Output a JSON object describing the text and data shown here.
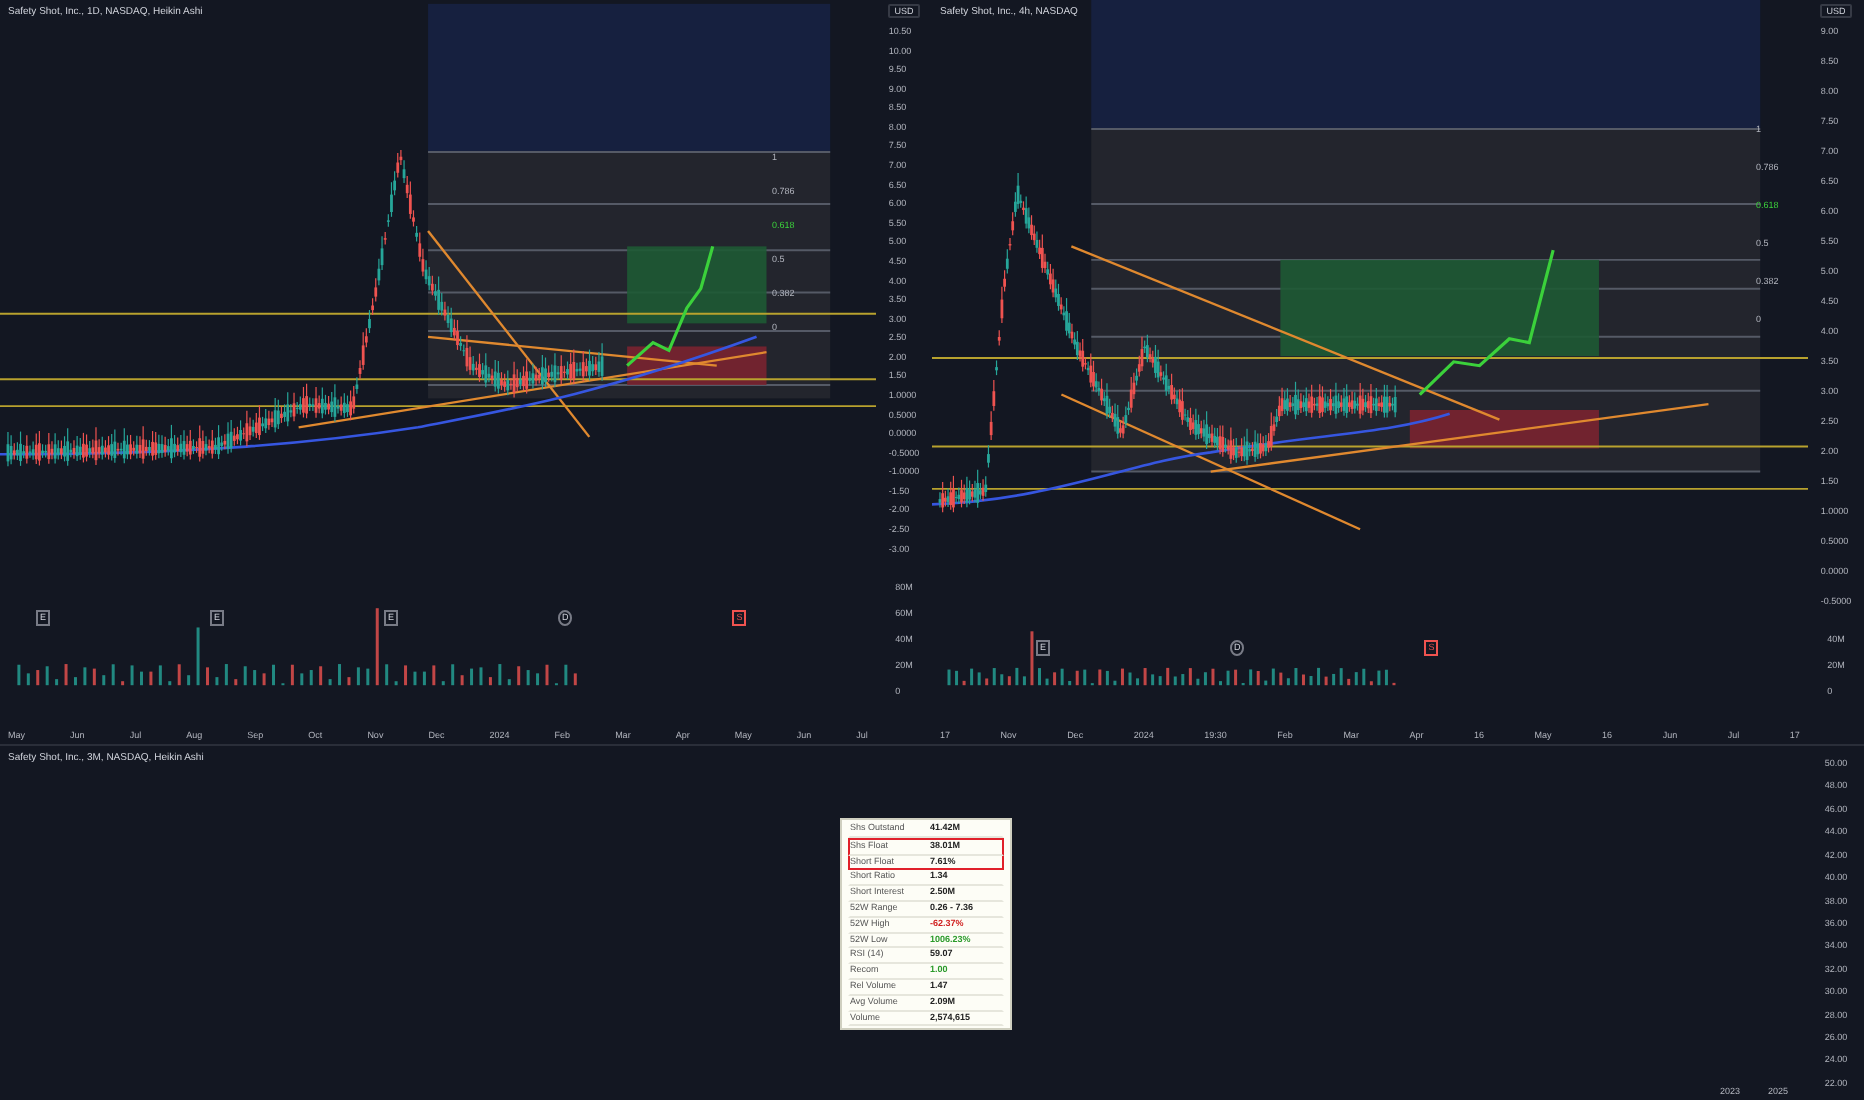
{
  "charts": [
    {
      "title": "Safety Shot, Inc., 1D, NASDAQ, Heikin Ashi",
      "currency": "USD",
      "price_ticks": [
        "10.50",
        "10.00",
        "9.50",
        "9.00",
        "8.50",
        "8.00",
        "7.50",
        "7.00",
        "6.50",
        "6.00",
        "5.50",
        "5.00",
        "4.50",
        "4.00",
        "3.50",
        "3.00",
        "2.50",
        "2.00",
        "1.50",
        "1.0000",
        "0.5000",
        "0.0000",
        "-0.5000",
        "-1.0000",
        "-1.50",
        "-2.00",
        "-2.50",
        "-3.00"
      ],
      "volume_ticks": [
        "80M",
        "60M",
        "40M",
        "20M",
        "0"
      ],
      "x_labels": [
        "May",
        "Jun",
        "Jul",
        "Aug",
        "Sep",
        "Oct",
        "Nov",
        "Dec",
        "2024",
        "Feb",
        "Mar",
        "Apr",
        "May",
        "Jun",
        "Jul"
      ],
      "fib_labels": [
        "1",
        "0.786",
        "0.618",
        "0.5",
        "0.382",
        "0"
      ],
      "events": [
        {
          "kind": "earnings",
          "label": "E"
        },
        {
          "kind": "earnings",
          "label": "E"
        },
        {
          "kind": "earnings",
          "label": "E"
        },
        {
          "kind": "dividend",
          "label": "D"
        },
        {
          "kind": "split",
          "label": "S"
        }
      ]
    },
    {
      "title": "Safety Shot, Inc., 4h, NASDAQ",
      "currency": "USD",
      "price_ticks": [
        "9.00",
        "8.50",
        "8.00",
        "7.50",
        "7.00",
        "6.50",
        "6.00",
        "5.50",
        "5.00",
        "4.50",
        "4.00",
        "3.50",
        "3.00",
        "2.50",
        "2.00",
        "1.50",
        "1.0000",
        "0.5000",
        "0.0000",
        "-0.5000"
      ],
      "volume_ticks": [
        "40M",
        "20M",
        "0"
      ],
      "x_labels": [
        "17",
        "Nov",
        "Dec",
        "2024",
        "19:30",
        "Feb",
        "Mar",
        "Apr",
        "16",
        "May",
        "16",
        "Jun",
        "Jul",
        "17"
      ],
      "fib_labels": [
        "1",
        "0.786",
        "0.618",
        "0.5",
        "0.382",
        "0"
      ],
      "events": [
        {
          "kind": "earnings",
          "label": "E"
        },
        {
          "kind": "dividend",
          "label": "D"
        },
        {
          "kind": "split",
          "label": "S"
        }
      ]
    }
  ],
  "bottom": {
    "title": "Safety Shot, Inc., 3M, NASDAQ, Heikin Ashi",
    "price_ticks": [
      "50.00",
      "48.00",
      "46.00",
      "44.00",
      "42.00",
      "40.00",
      "38.00",
      "36.00",
      "34.00",
      "32.00",
      "30.00",
      "28.00",
      "26.00",
      "24.00",
      "22.00"
    ],
    "x_labels": [
      "2023",
      "2025"
    ],
    "stats": [
      {
        "label": "Shs Outstand",
        "value": "41.42M",
        "highlighted": false,
        "color": "#222222"
      },
      {
        "label": "Shs Float",
        "value": "38.01M",
        "highlighted": true,
        "color": "#222222"
      },
      {
        "label": "Short Float",
        "value": "7.61%",
        "highlighted": true,
        "color": "#222222"
      },
      {
        "label": "Short Ratio",
        "value": "1.34",
        "highlighted": false,
        "color": "#222222"
      },
      {
        "label": "Short Interest",
        "value": "2.50M",
        "highlighted": false,
        "color": "#222222"
      },
      {
        "label": "52W Range",
        "value": "0.26 - 7.36",
        "highlighted": false,
        "color": "#222222"
      },
      {
        "label": "52W High",
        "value": "-62.37%",
        "highlighted": false,
        "color": "#d02020"
      },
      {
        "label": "52W Low",
        "value": "1006.23%",
        "highlighted": false,
        "color": "#2a9a2a"
      },
      {
        "label": "RSI (14)",
        "value": "59.07",
        "highlighted": false,
        "color": "#222222"
      },
      {
        "label": "Recom",
        "value": "1.00",
        "highlighted": false,
        "color": "#2a9a2a"
      },
      {
        "label": "Rel Volume",
        "value": "1.47",
        "highlighted": false,
        "color": "#222222"
      },
      {
        "label": "Avg Volume",
        "value": "2.09M",
        "highlighted": false,
        "color": "#222222"
      },
      {
        "label": "Volume",
        "value": "2,574,615",
        "highlighted": false,
        "color": "#222222"
      }
    ]
  }
}
